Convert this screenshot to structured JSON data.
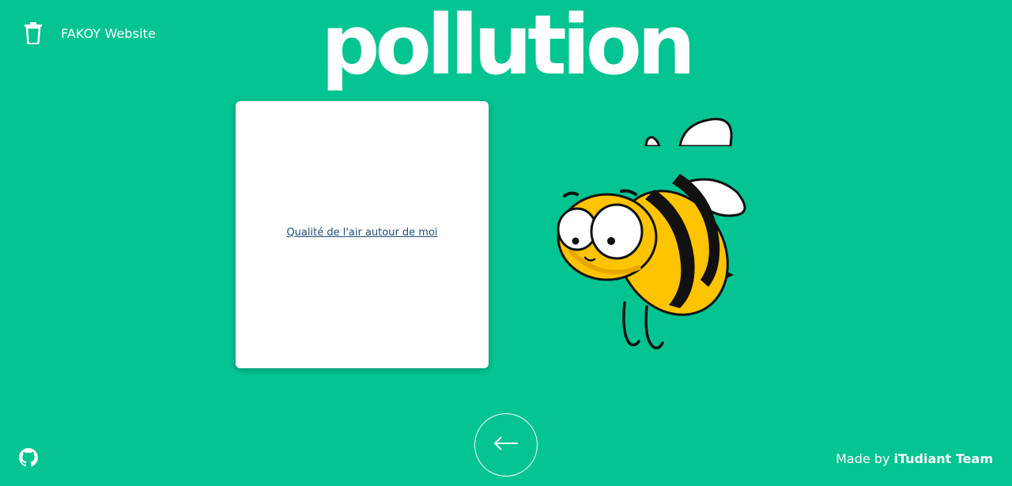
{
  "header": {
    "brand_icon": "trash-icon",
    "brand_label": "FAKOY Website"
  },
  "main": {
    "title": "pollution",
    "card": {
      "link_label": "Qualité de l'air autour de moi"
    },
    "illustration": "bee-illustration"
  },
  "footer": {
    "back_icon": "arrow-left-icon",
    "github_icon": "github-icon",
    "credit_prefix": "Made by",
    "credit_team": "iTudiant Team"
  },
  "colors": {
    "background": "#04c491",
    "text": "#ffffff",
    "link": "#1a4e7a",
    "bee_yellow": "#ffc400",
    "bee_stripe": "#111111"
  }
}
